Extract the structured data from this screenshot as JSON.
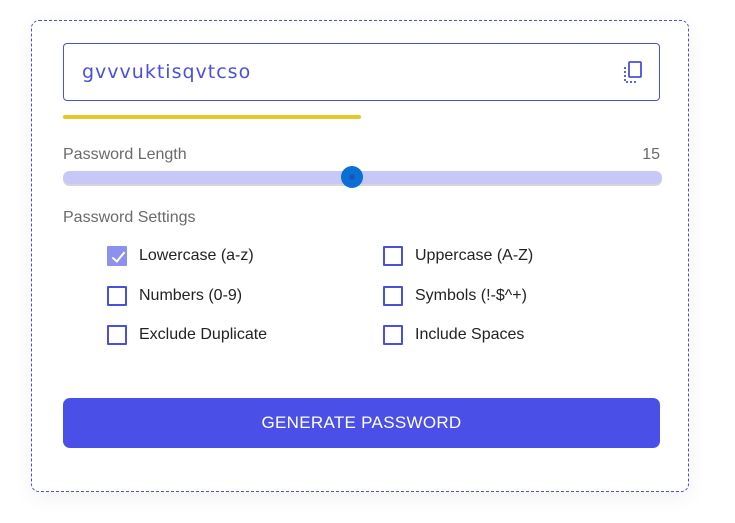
{
  "password": {
    "value": "gvvvuktisqvtcso",
    "copy_icon": "copy-icon"
  },
  "strength": {
    "color": "#e8c72a"
  },
  "length": {
    "label": "Password Length",
    "value": "15",
    "slider_fraction": 0.483
  },
  "settings": {
    "title": "Password Settings",
    "options": [
      {
        "label": "Lowercase (a-z)",
        "checked": true
      },
      {
        "label": "Uppercase (A-Z)",
        "checked": false
      },
      {
        "label": "Numbers (0-9)",
        "checked": false
      },
      {
        "label": "Symbols (!-$^+)",
        "checked": false
      },
      {
        "label": "Exclude Duplicate",
        "checked": false
      },
      {
        "label": "Include Spaces",
        "checked": false
      }
    ]
  },
  "generate_button": {
    "label": "GENERATE PASSWORD"
  },
  "colors": {
    "accent": "#4a4fe7",
    "thumb": "#0c6fd6",
    "track": "#c7c8f7"
  }
}
